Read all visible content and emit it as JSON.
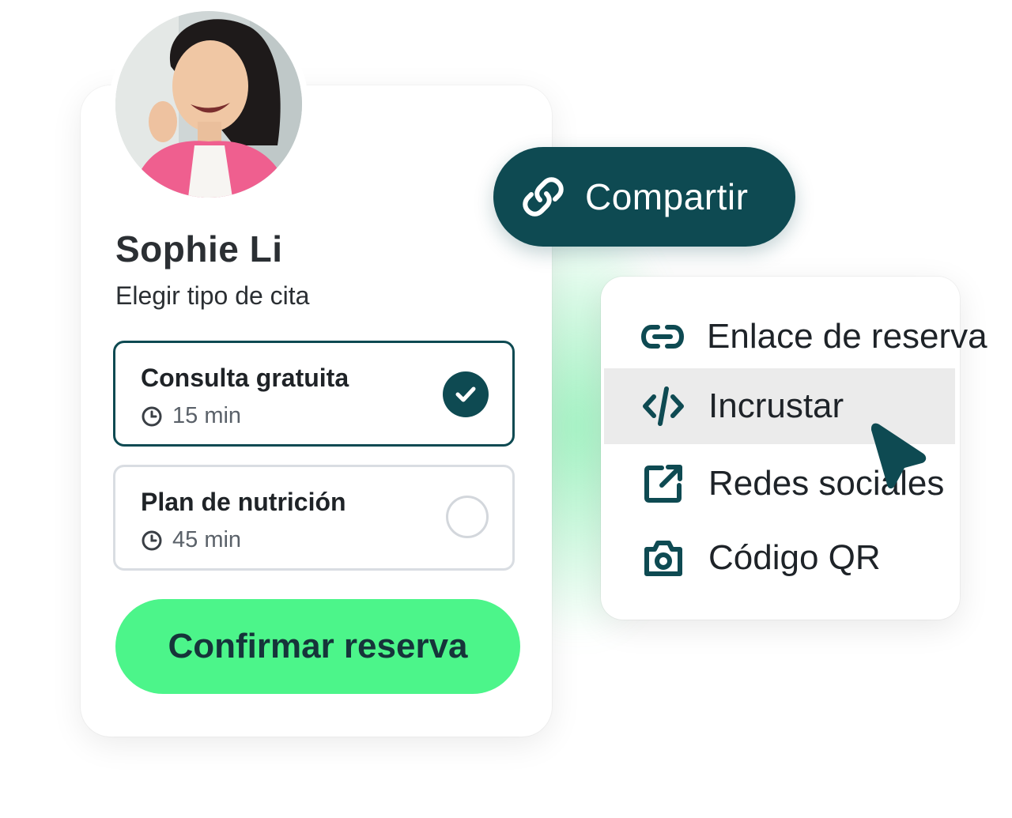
{
  "profile": {
    "name": "Sophie Li",
    "subtitle": "Elegir tipo de cita"
  },
  "options": [
    {
      "title": "Consulta gratuita",
      "duration": "15 min",
      "selected": true
    },
    {
      "title": "Plan de nutrición",
      "duration": "45 min",
      "selected": false
    }
  ],
  "confirm_label": "Confirmar reserva",
  "share_label": "Compartir",
  "share_menu": [
    {
      "label": "Enlace de reserva",
      "icon": "link-icon"
    },
    {
      "label": "Incrustar",
      "icon": "code-icon",
      "highlighted": true
    },
    {
      "label": "Redes sociales",
      "icon": "external-link-icon"
    },
    {
      "label": "Código QR",
      "icon": "camera-icon"
    }
  ],
  "colors": {
    "primary": "#0e4a52",
    "accent_green": "#4cf58a",
    "highlight_bg": "#ebebeb"
  }
}
